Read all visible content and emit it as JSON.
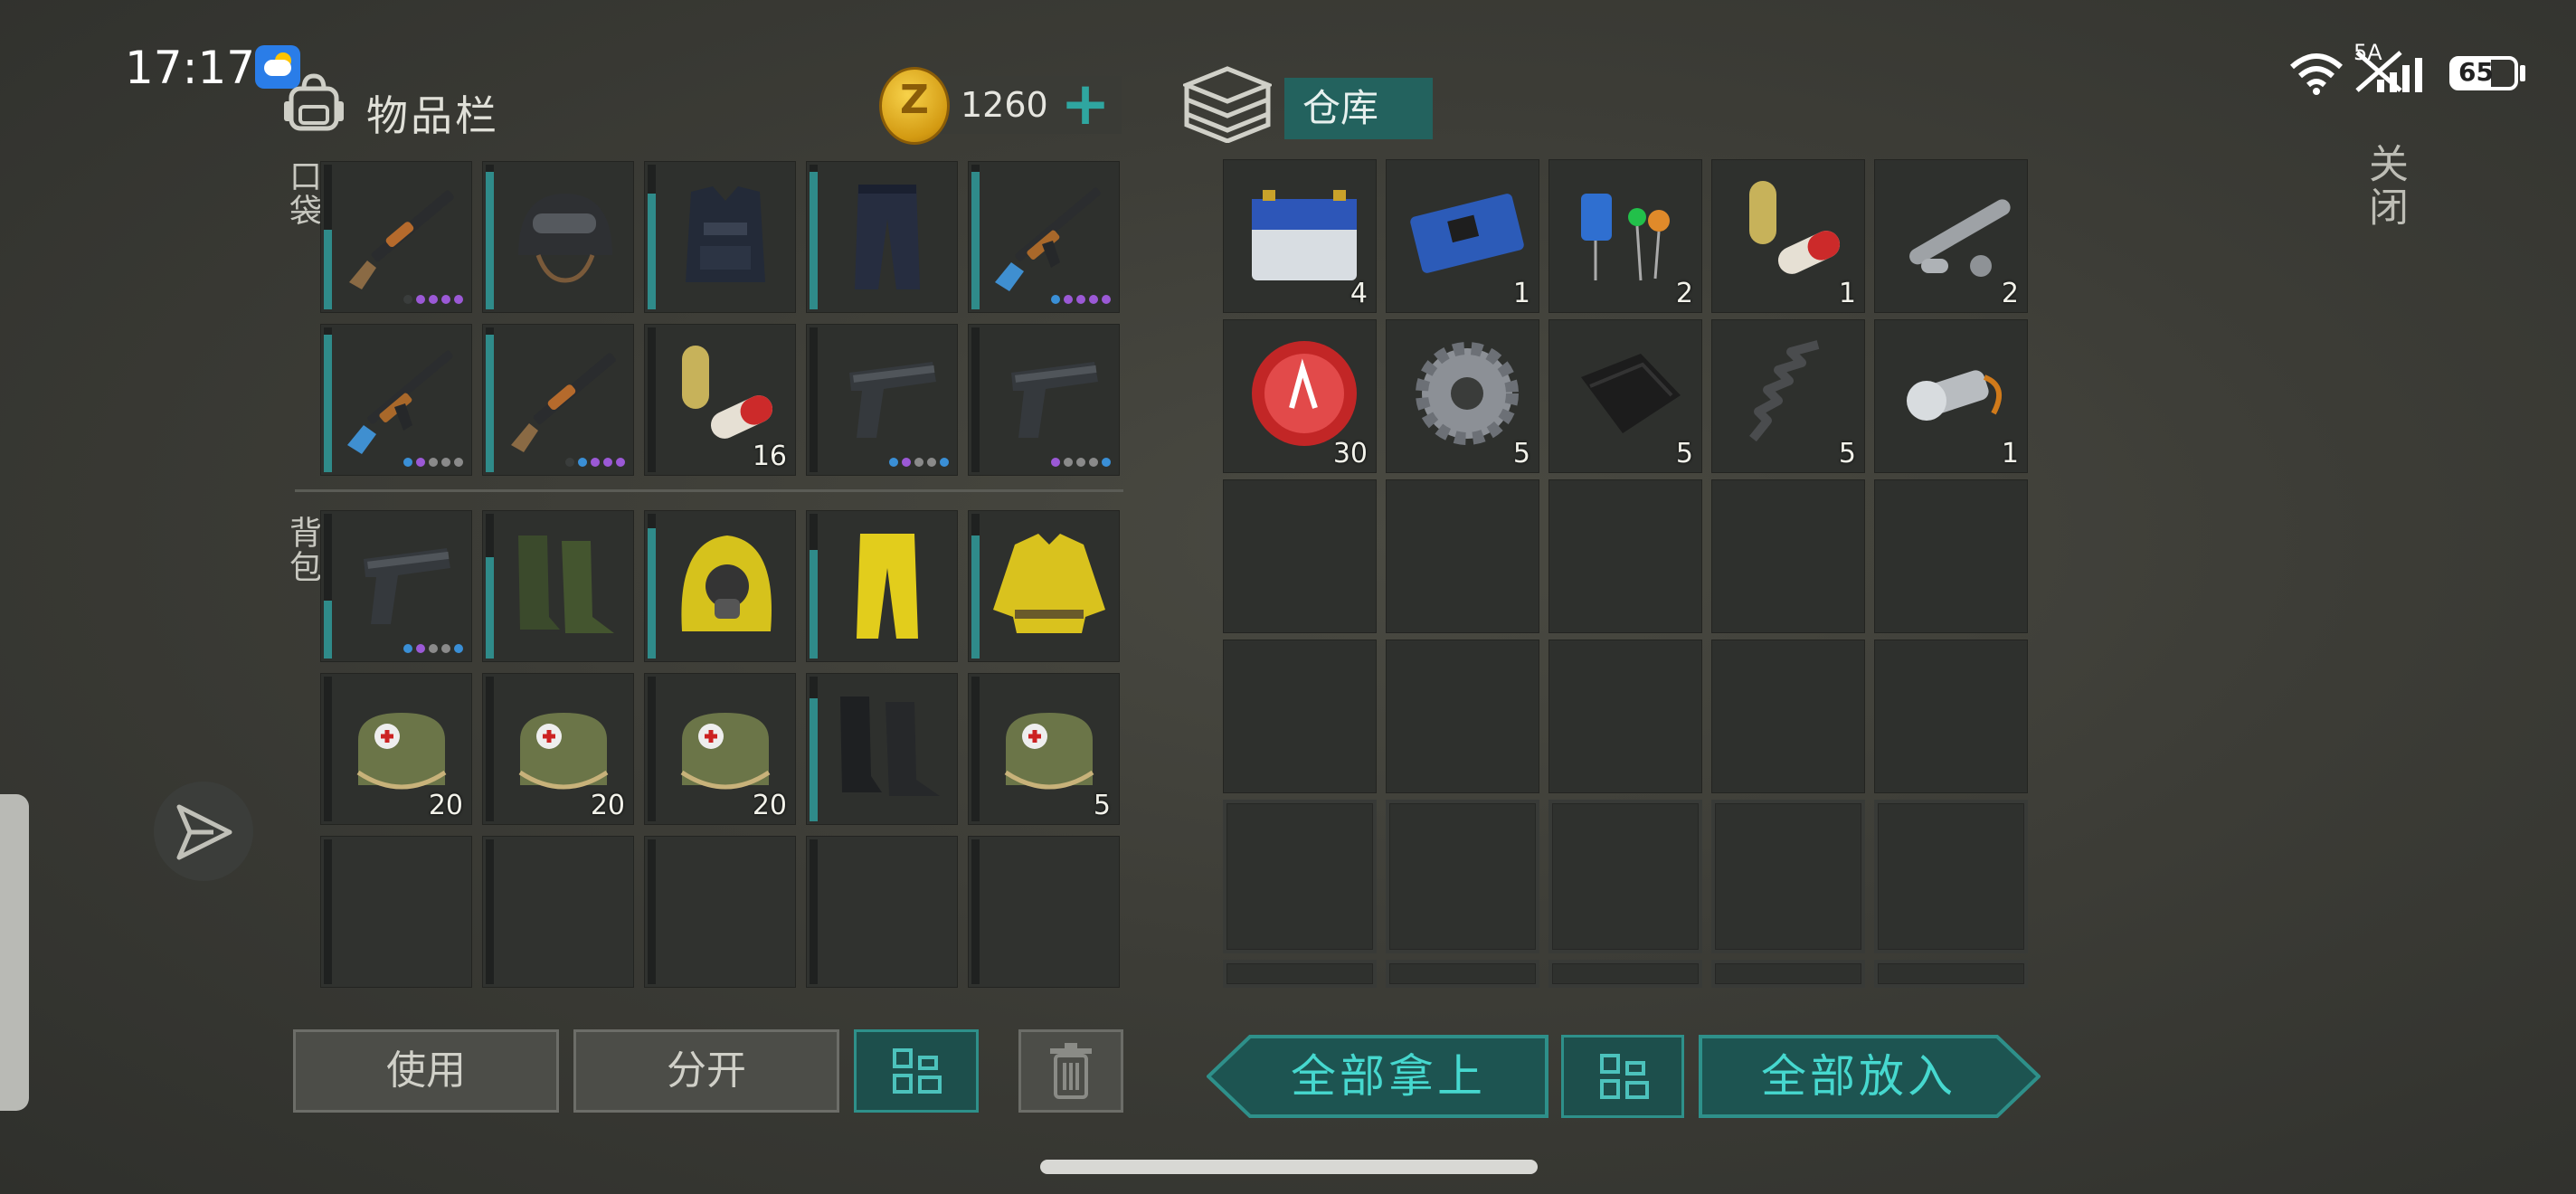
{
  "status_bar": {
    "time": "17:17",
    "network": "5A",
    "battery": "65",
    "weather_icon": "partly-cloudy-icon"
  },
  "inventory": {
    "title": "物品栏",
    "coins": "1260",
    "add_coins_icon": "plus-icon",
    "pocket_label": "口袋",
    "backpack_label": "背包",
    "pocket_slots": [
      {
        "item": "shotgun",
        "count": "",
        "durability": 0.55,
        "dots": [
          "#3a3d3c",
          "#9b59d6",
          "#9b59d6",
          "#9b59d6",
          "#9b59d6"
        ]
      },
      {
        "item": "tactical-helmet",
        "count": "",
        "durability": 0.95,
        "dots": []
      },
      {
        "item": "police-vest",
        "count": "",
        "durability": 0.8,
        "dots": []
      },
      {
        "item": "police-pants",
        "count": "",
        "durability": 0.95,
        "dots": []
      },
      {
        "item": "assault-rifle",
        "count": "",
        "durability": 0.95,
        "dots": [
          "#3a8fd6",
          "#9b59d6",
          "#9b59d6",
          "#9b59d6",
          "#9b59d6"
        ]
      },
      {
        "item": "assault-rifle",
        "count": "",
        "durability": 0.95,
        "dots": [
          "#3a8fd6",
          "#9b59d6",
          "#8a8a8a",
          "#8a8a8a",
          "#8a8a8a"
        ]
      },
      {
        "item": "shotgun",
        "count": "",
        "durability": 0.95,
        "dots": [
          "#3a3d3c",
          "#3a8fd6",
          "#9b59d6",
          "#9b59d6",
          "#9b59d6"
        ]
      },
      {
        "item": "pills",
        "count": "16",
        "durability": 0,
        "dots": []
      },
      {
        "item": "pistol",
        "count": "",
        "durability": 0,
        "dots": [
          "#3a8fd6",
          "#9b59d6",
          "#8a8a8a",
          "#8a8a8a",
          "#3a8fd6"
        ]
      },
      {
        "item": "pistol",
        "count": "",
        "durability": 0,
        "dots": [
          "#9b59d6",
          "#8a8a8a",
          "#8a8a8a",
          "#8a8a8a",
          "#3a8fd6"
        ]
      }
    ],
    "backpack_slots": [
      {
        "item": "pistol",
        "count": "",
        "durability": 0.4,
        "dots": [
          "#3a8fd6",
          "#9b59d6",
          "#8a8a8a",
          "#8a8a8a",
          "#3a8fd6"
        ]
      },
      {
        "item": "rubber-boots",
        "count": "",
        "durability": 0.7,
        "dots": []
      },
      {
        "item": "hazmat-hood",
        "count": "",
        "durability": 0.9,
        "dots": []
      },
      {
        "item": "hazmat-pants",
        "count": "",
        "durability": 0.75,
        "dots": []
      },
      {
        "item": "hazmat-jacket",
        "count": "",
        "durability": 0.85,
        "dots": []
      },
      {
        "item": "medkit",
        "count": "20",
        "durability": 0,
        "dots": []
      },
      {
        "item": "medkit",
        "count": "20",
        "durability": 0,
        "dots": []
      },
      {
        "item": "medkit",
        "count": "20",
        "durability": 0,
        "dots": []
      },
      {
        "item": "combat-boots",
        "count": "",
        "durability": 0.85,
        "dots": []
      },
      {
        "item": "medkit",
        "count": "5",
        "durability": 0,
        "dots": []
      },
      {
        "item": "",
        "count": "",
        "durability": 0,
        "dots": []
      },
      {
        "item": "",
        "count": "",
        "durability": 0,
        "dots": []
      },
      {
        "item": "",
        "count": "",
        "durability": 0,
        "dots": []
      },
      {
        "item": "",
        "count": "",
        "durability": 0,
        "dots": []
      },
      {
        "item": "",
        "count": "",
        "durability": 0,
        "dots": []
      }
    ],
    "use_label": "使用",
    "split_label": "分开",
    "sort_icon": "grid-sort-icon",
    "trash_icon": "trash-icon"
  },
  "warehouse": {
    "title": "仓库",
    "slots": [
      {
        "item": "battery",
        "count": "4"
      },
      {
        "item": "circuit-board",
        "count": "1"
      },
      {
        "item": "electronic-components",
        "count": "2"
      },
      {
        "item": "pills",
        "count": "1"
      },
      {
        "item": "pipe-parts",
        "count": "2"
      },
      {
        "item": "bottle-cap",
        "count": "30"
      },
      {
        "item": "gear",
        "count": "5"
      },
      {
        "item": "leather",
        "count": "5"
      },
      {
        "item": "spring",
        "count": "5"
      },
      {
        "item": "flashlight",
        "count": "1"
      }
    ],
    "take_all_label": "全部拿上",
    "put_all_label": "全部放入",
    "sort_icon": "grid-sort-icon"
  },
  "close_label": "关闭",
  "send_icon": "send-icon"
}
